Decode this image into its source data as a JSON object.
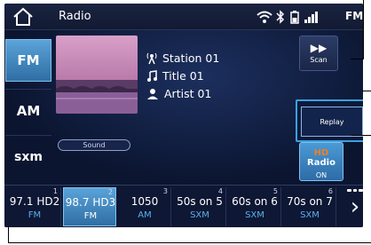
{
  "status_bar": {
    "title": "Radio",
    "icons": [
      "home-icon",
      "wifi-icon",
      "bluetooth-icon",
      "battery-icon",
      "signal-icon"
    ],
    "signal_label": "FM"
  },
  "sources": [
    {
      "label": "FM",
      "selected": true
    },
    {
      "label": "AM",
      "selected": false
    },
    {
      "label": "sxm",
      "selected": false
    }
  ],
  "now_playing": {
    "station": "Station 01",
    "title": "Title 01",
    "artist": "Artist 01"
  },
  "sound_button": "Sound",
  "right_panel": {
    "scan_label": "Scan",
    "replay_label": "Replay",
    "hd_radio_label": "Radio",
    "hd_radio_state": "ON",
    "page_numbers": [
      "1",
      "2",
      "3"
    ]
  },
  "presets": [
    {
      "num": "1",
      "freq": "97.1 HD2",
      "band": "FM",
      "active": false
    },
    {
      "num": "2",
      "freq": "98.7 HD3",
      "band": "FM",
      "active": true
    },
    {
      "num": "3",
      "freq": "1050",
      "band": "AM",
      "active": false
    },
    {
      "num": "4",
      "freq": "50s on 5",
      "band": "SXM",
      "active": false
    },
    {
      "num": "5",
      "freq": "60s on 6",
      "band": "SXM",
      "active": false
    },
    {
      "num": "6",
      "freq": "70s on 7",
      "band": "SXM",
      "active": false
    }
  ],
  "colors": {
    "accent": "#3ea0e0",
    "background": "#0a1228",
    "highlight": "#f08020"
  }
}
